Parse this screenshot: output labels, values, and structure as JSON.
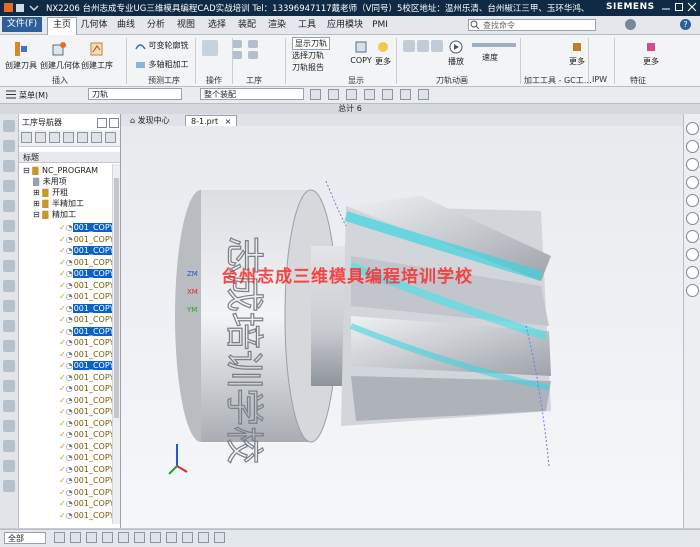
{
  "window": {
    "title": "NX2206 台州志成专业UG三维模具编程CAD实战培训  Tel：13396947117戴老师（V同号）5校区地址：温州乐清、台州椒江三甲、玉环华鸿、玉环沙门、玉环坎门 - 加工",
    "brand": "SIEMENS"
  },
  "menu": {
    "file": "文件(F)",
    "tabs": [
      "主页",
      "几何体",
      "曲线",
      "分析",
      "视图",
      "选择",
      "装配",
      "渲染",
      "工具",
      "应用模块",
      "PMI"
    ],
    "active_tab": "主页",
    "search_placeholder": "查找命令"
  },
  "ribbon": {
    "buttons": {
      "create_tool": "创建刀具",
      "create_geometry": "创建几何体",
      "create_operation": "创建工序",
      "variable_contour": "可变轮廓铣",
      "multi_axis_rough": "多轴粗加工",
      "show_toolpath": "显示刀轨",
      "select_toolpath": "选择刀轨",
      "toolpath_report": "刀轨报告",
      "more1": "更多",
      "more2": "更多",
      "more3": "更多",
      "more4": "更多",
      "play": "播放",
      "speed": "速度",
      "copy": "COPY"
    },
    "groups": [
      "插入",
      "预测工序",
      "操作",
      "工序",
      "显示",
      "刀轨动画",
      "加工工具 - GC工…",
      "IPW",
      "特征"
    ]
  },
  "toolbar2": {
    "menu": "菜单(M)",
    "filter": "刀轨",
    "scope": "整个装配"
  },
  "header": {
    "label": "总计 6"
  },
  "navigator": {
    "title": "工序导航器",
    "column": "标题",
    "root": "NC_PROGRAM",
    "unused": "未用项",
    "groups": [
      "开粗",
      "半精加工",
      "精加工"
    ],
    "items": [
      {
        "label": "001_COPY",
        "selected": true
      },
      {
        "label": "001_COPY",
        "selected": false
      },
      {
        "label": "001_COPY",
        "selected": true
      },
      {
        "label": "001_COPY",
        "selected": false
      },
      {
        "label": "001_COPY",
        "selected": true
      },
      {
        "label": "001_COPY",
        "selected": false
      },
      {
        "label": "001_COPY",
        "selected": false
      },
      {
        "label": "001_COPY",
        "selected": true
      },
      {
        "label": "001_COPY",
        "selected": false
      },
      {
        "label": "001_COPY",
        "selected": true
      },
      {
        "label": "001_COPY",
        "selected": false
      },
      {
        "label": "001_COPY",
        "selected": false
      },
      {
        "label": "001_COPY",
        "selected": true
      },
      {
        "label": "001_COPY",
        "selected": false
      },
      {
        "label": "001_COPY",
        "selected": false
      },
      {
        "label": "001_COPY",
        "selected": false
      },
      {
        "label": "001_COPY",
        "selected": false
      },
      {
        "label": "001_COPY",
        "selected": false
      },
      {
        "label": "001_COPY",
        "selected": false
      },
      {
        "label": "001_COPY",
        "selected": false
      },
      {
        "label": "001_COPY",
        "selected": false
      },
      {
        "label": "001_COPY",
        "selected": false
      },
      {
        "label": "001_COPY",
        "selected": false
      },
      {
        "label": "001_COPY",
        "selected": false
      },
      {
        "label": "001_COPY",
        "selected": false
      },
      {
        "label": "001_COPY",
        "selected": false
      }
    ]
  },
  "doc_tabs": [
    "发现中心",
    "8-1.prt"
  ],
  "active_doc": "8-1.prt",
  "viewport": {
    "watermark": "台州志成三维模具编程培训学校",
    "part_text": "志成培训学校",
    "axis_labels": {
      "zm": "ZM",
      "xm": "XM",
      "ym": "YM"
    }
  },
  "status": {
    "filter": "全部"
  }
}
